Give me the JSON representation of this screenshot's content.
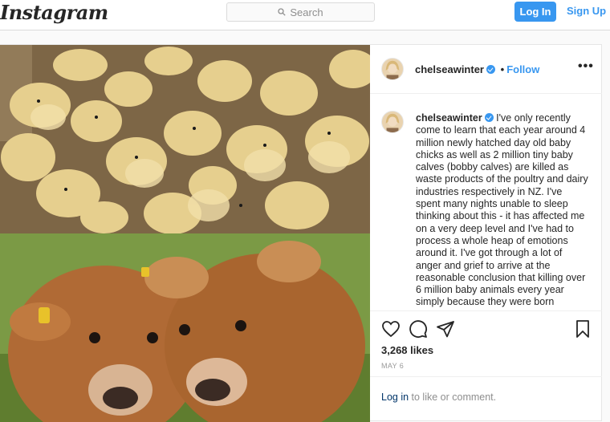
{
  "header": {
    "logo": "Instagram",
    "search_placeholder": "Search",
    "login_label": "Log In",
    "signup_label": "Sign Up"
  },
  "post": {
    "username": "chelseawinter",
    "follow_label": "Follow",
    "separator": "•",
    "caption_user": "chelseawinter",
    "caption_text": "I've only recently come to learn that each year around 4 million newly hatched day old baby chicks as well as 2 million tiny baby calves (bobby calves) are killed as waste products of the poultry and dairy industries respectively in NZ. I've spent many nights unable to sleep thinking about this - it has affected me on a very deep level and I've had to process a whole heap of emotions around it. I've got through a lot of anger and grief to arrive at the reasonable conclusion that killing over 6 million baby animals every year simply because they were born",
    "likes": "3,268 likes",
    "date": "MAY 6",
    "footer_login": "Log in",
    "footer_rest": " to like or comment.",
    "more_label": "•••"
  },
  "colors": {
    "accent": "#3897f0",
    "border": "#dbdbdb",
    "muted": "#8e8e8e"
  },
  "icons": [
    "search-icon",
    "verified-badge-icon",
    "more-options-icon",
    "heart-icon",
    "comment-icon",
    "share-icon",
    "bookmark-icon"
  ]
}
